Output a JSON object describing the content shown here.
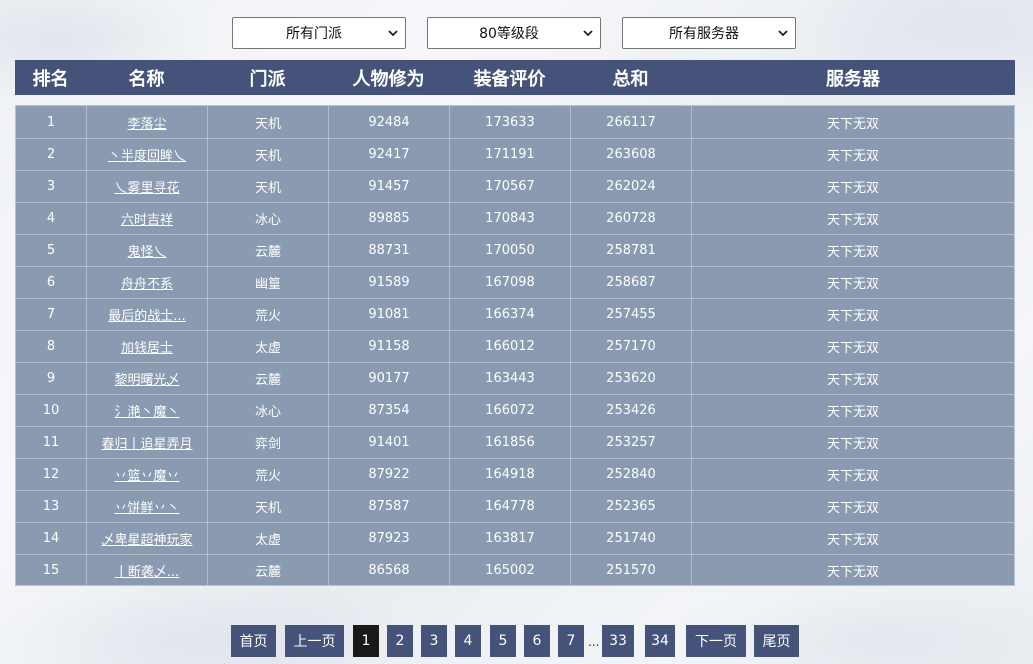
{
  "filters": {
    "faction": "所有门派",
    "level": "80等级段",
    "server": "所有服务器"
  },
  "columns": [
    "排名",
    "名称",
    "门派",
    "人物修为",
    "装备评价",
    "总和",
    "服务器"
  ],
  "rows": [
    [
      "1",
      "李落尘",
      "天机",
      "92484",
      "173633",
      "266117",
      "天下无双"
    ],
    [
      "2",
      "丶半度回眸乀",
      "天机",
      "92417",
      "171191",
      "263608",
      "天下无双"
    ],
    [
      "3",
      "乀雾里寻花",
      "天机",
      "91457",
      "170567",
      "262024",
      "天下无双"
    ],
    [
      "4",
      "六时吉祥",
      "冰心",
      "89885",
      "170843",
      "260728",
      "天下无双"
    ],
    [
      "5",
      "鬼怪乀",
      "云麓",
      "88731",
      "170050",
      "258781",
      "天下无双"
    ],
    [
      "6",
      "舟舟不系",
      "幽篁",
      "91589",
      "167098",
      "258687",
      "天下无双"
    ],
    [
      "7",
      "最后的战士...",
      "荒火",
      "91081",
      "166374",
      "257455",
      "天下无双"
    ],
    [
      "8",
      "加钱居士",
      "太虚",
      "91158",
      "166012",
      "257170",
      "天下无双"
    ],
    [
      "9",
      "黎明曙光乄",
      "云麓",
      "90177",
      "163443",
      "253620",
      "天下无双"
    ],
    [
      "10",
      "氵滟丶魔丶",
      "冰心",
      "87354",
      "166072",
      "253426",
      "天下无双"
    ],
    [
      "11",
      "春归丨追星弄月",
      "弈剑",
      "91401",
      "161856",
      "253257",
      "天下无双"
    ],
    [
      "12",
      "丷篮丷魔丷",
      "荒火",
      "87922",
      "164918",
      "252840",
      "天下无双"
    ],
    [
      "13",
      "丷饼鲜丷丶",
      "天机",
      "87587",
      "164778",
      "252365",
      "天下无双"
    ],
    [
      "14",
      "乄卑星超神玩家",
      "太虚",
      "87923",
      "163817",
      "251740",
      "天下无双"
    ],
    [
      "15",
      "丨断袭乄...",
      "云麓",
      "86568",
      "165002",
      "251570",
      "天下无双"
    ]
  ],
  "pagination": {
    "first": "首页",
    "prev": "上一页",
    "pages": [
      "1",
      "2",
      "3",
      "4",
      "5",
      "6",
      "7"
    ],
    "current": "1",
    "ellipsis": "...",
    "tail_pages": [
      "33",
      "34"
    ],
    "next": "下一页",
    "last": "尾页"
  },
  "colors": {
    "header_bg": "#45537a",
    "row_bg": "#8a9ab0",
    "active_page": "#1a1a1a"
  }
}
